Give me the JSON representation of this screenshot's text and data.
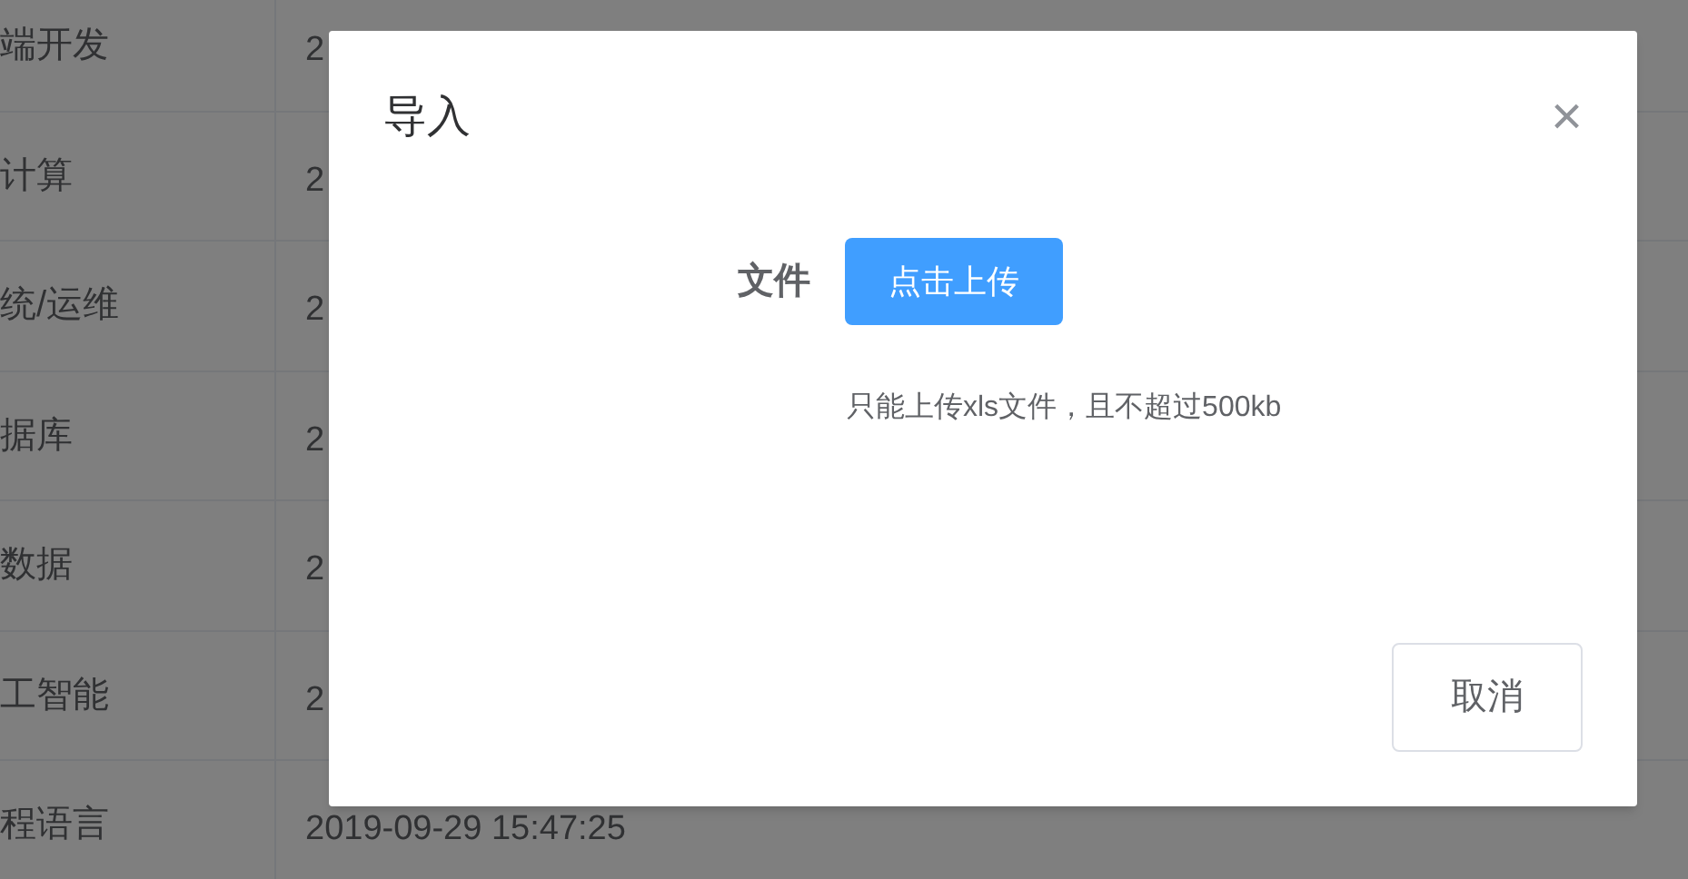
{
  "table": {
    "rows": [
      {
        "column_1": "端开发",
        "column_2": "2"
      },
      {
        "column_1": "计算",
        "column_2": "2"
      },
      {
        "column_1": "统/运维",
        "column_2": "2"
      },
      {
        "column_1": "据库",
        "column_2": "2"
      },
      {
        "column_1": "数据",
        "column_2": "2"
      },
      {
        "column_1": "工智能",
        "column_2": "2"
      },
      {
        "column_1": "程语言",
        "column_2": "2019-09-29 15:47:25"
      }
    ]
  },
  "dialog": {
    "title": "导入",
    "close": "×",
    "field_label": "文件",
    "upload_button": "点击上传",
    "tip": "只能上传xls文件，且不超过500kb",
    "cancel_button": "取消"
  }
}
